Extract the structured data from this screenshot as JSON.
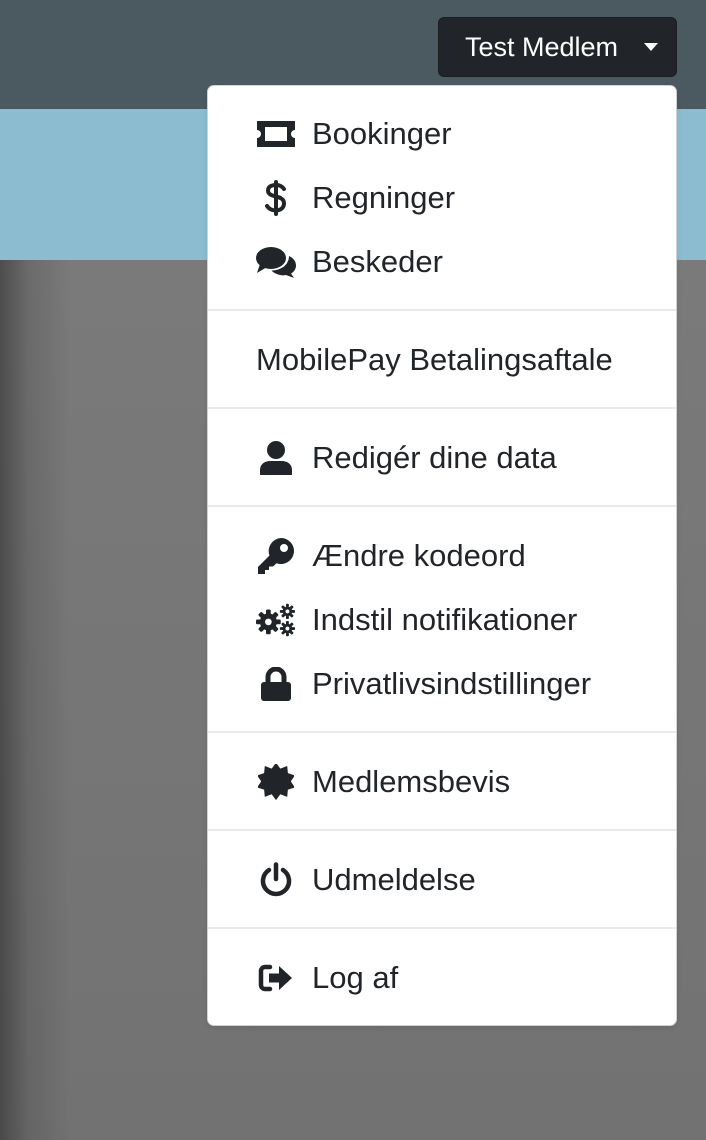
{
  "header": {
    "user_button_label": "Test Medlem"
  },
  "menu": {
    "items": [
      {
        "label": "Bookinger",
        "icon": "ticket-icon"
      },
      {
        "label": "Regninger",
        "icon": "dollar-icon"
      },
      {
        "label": "Beskeder",
        "icon": "comments-icon"
      },
      {
        "label": "MobilePay Betalingsaftale",
        "icon": ""
      },
      {
        "label": "Redigér dine data",
        "icon": "user-icon"
      },
      {
        "label": "Ændre kodeord",
        "icon": "key-icon"
      },
      {
        "label": "Indstil notifikationer",
        "icon": "cogs-icon"
      },
      {
        "label": "Privatlivsindstillinger",
        "icon": "lock-icon"
      },
      {
        "label": "Medlemsbevis",
        "icon": "certificate-icon"
      },
      {
        "label": "Udmeldelse",
        "icon": "power-icon"
      },
      {
        "label": "Log af",
        "icon": "sign-out-icon"
      }
    ]
  },
  "colors": {
    "topbar": "#4b5a61",
    "banner": "#8bbcd0",
    "button": "#212529",
    "menu_text": "#212529",
    "divider": "#e9ecef"
  }
}
